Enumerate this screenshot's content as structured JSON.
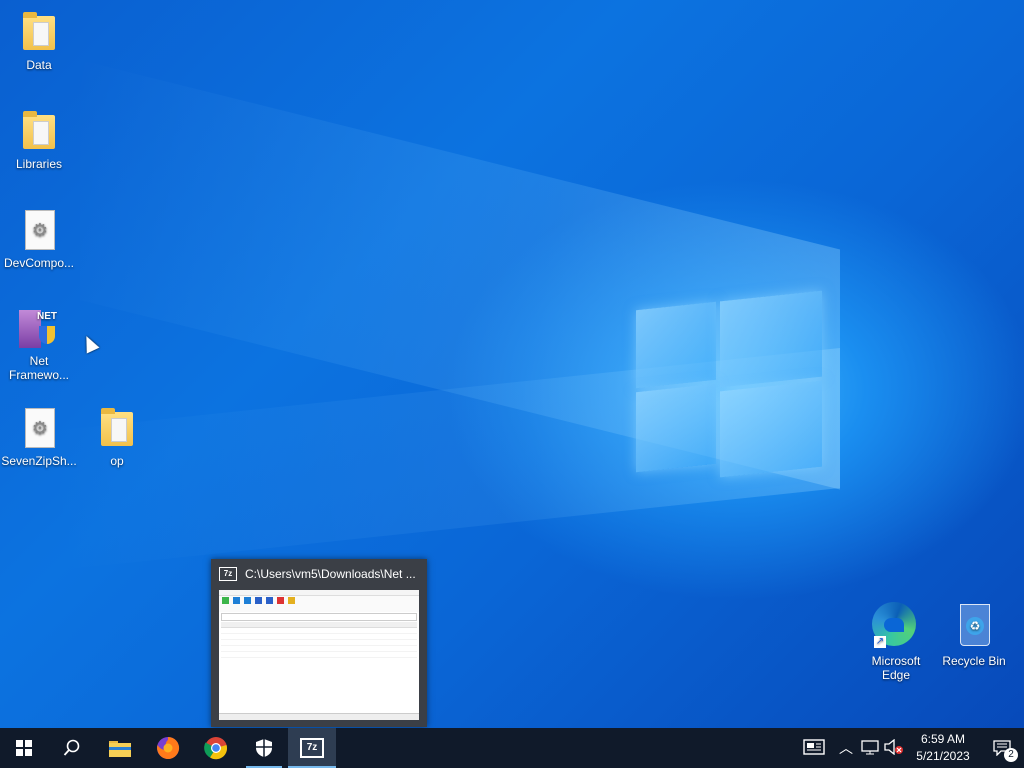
{
  "desktop": {
    "icons": [
      {
        "label": "Data"
      },
      {
        "label": "Libraries"
      },
      {
        "label": "DevCompo..."
      },
      {
        "label": "Net\nFramewo..."
      },
      {
        "label": "SevenZipSh..."
      },
      {
        "label": "op"
      },
      {
        "label": "Microsoft\nEdge"
      },
      {
        "label": "Recycle Bin"
      }
    ]
  },
  "thumbnail": {
    "title": "C:\\Users\\vm5\\Downloads\\Net ...",
    "app_badge": "7z"
  },
  "taskbar": {
    "clock_time": "6:59 AM",
    "clock_date": "5/21/2023",
    "notification_count": "2",
    "active_app_badge": "7z"
  },
  "colors": {
    "taskbar_bg": "#101a2a",
    "accent": "#76b9ed"
  }
}
